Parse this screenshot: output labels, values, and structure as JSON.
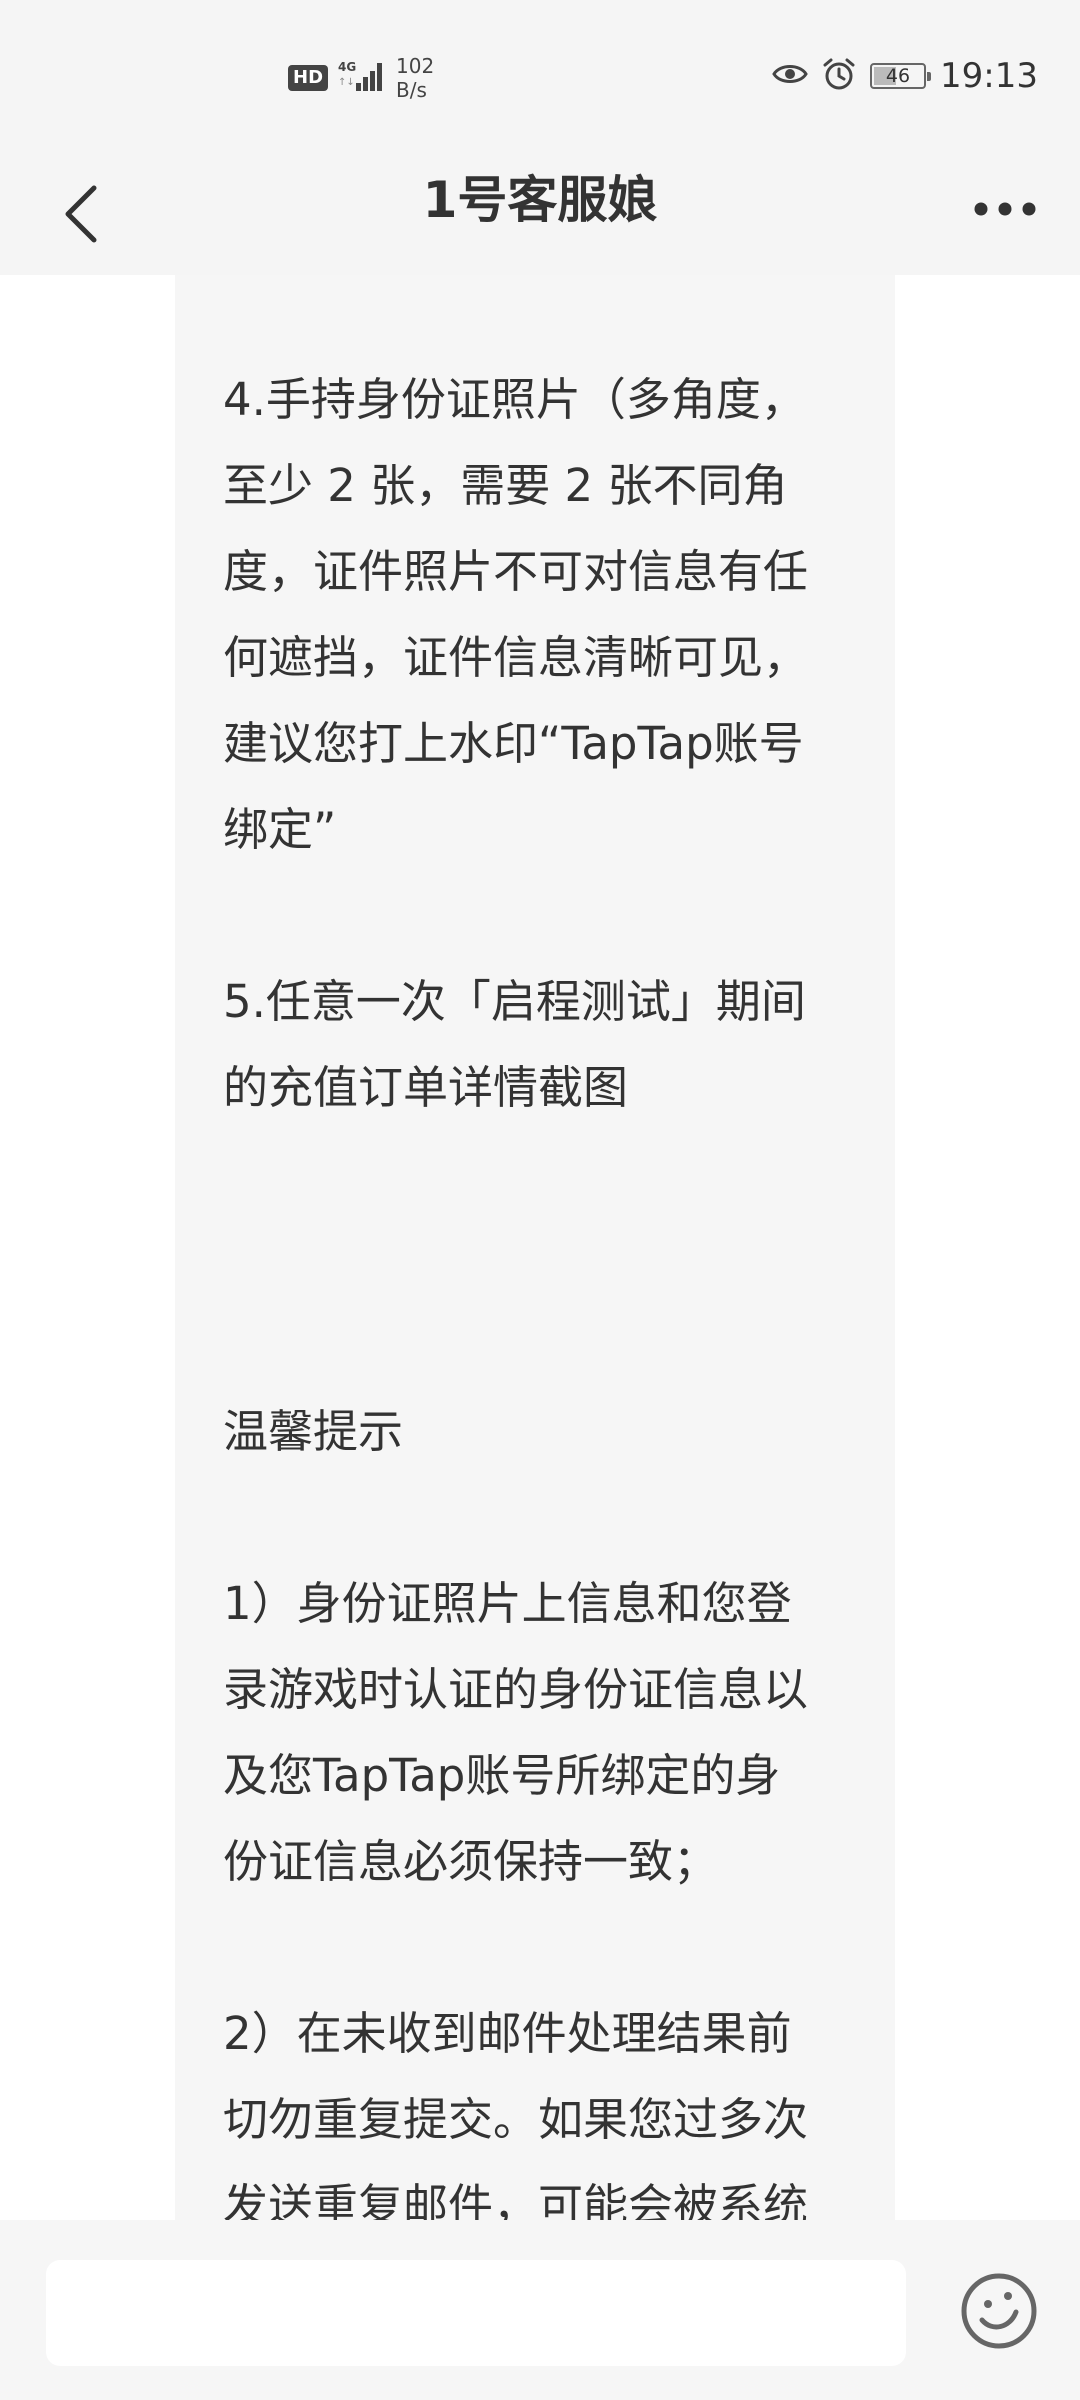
{
  "status_bar": {
    "hd_label": "HD",
    "network_label": "4G",
    "net_speed_value": "102",
    "net_speed_unit": "B/s",
    "battery_level": "46",
    "time": "19:13"
  },
  "nav": {
    "title": "1号客服娘"
  },
  "message": {
    "text": "4.手持身份证照片（多角度，\n至少 2 张，需要 2 张不同角\n度，证件照片不可对信息有任\n何遮挡，证件信息清晰可见，\n建议您打上水印“TapTap账号\n绑定”\n\n5.任意一次「启程测试」期间\n的充值订单详情截图\n\n\n\n温馨提示\n\n1）身份证照片上信息和您登\n录游戏时认证的身份证信息以\n及您TapTap账号所绑定的身\n份证信息必须保持一致；\n\n2）在未收到邮件处理结果前\n切勿重复提交。如果您过多次\n发送重复邮件，可能会被系统"
  },
  "input_bar": {
    "input_value": "",
    "emoji_icon": "emoji-icon"
  },
  "colors": {
    "bar_bg": "#f5f5f5",
    "bubble_bg": "#f6f6f6",
    "text": "#333333"
  }
}
